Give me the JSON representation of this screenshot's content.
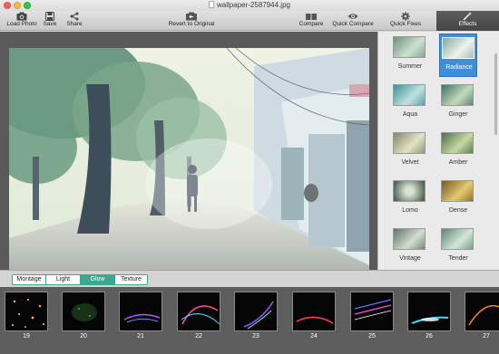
{
  "window": {
    "title": "wallpaper-2587944.jpg"
  },
  "toolbar": {
    "load_photo": "Load Photo",
    "save": "Save",
    "share": "Share",
    "revert": "Revert to Original",
    "compare": "Compare",
    "quick_compare": "Quick Compare",
    "quick_fixes": "Quick Fixes",
    "effects": "Effects"
  },
  "presets": [
    {
      "label": "Summer",
      "selected": false
    },
    {
      "label": "Radiance",
      "selected": true
    },
    {
      "label": "Aqua",
      "selected": false
    },
    {
      "label": "Ginger",
      "selected": false
    },
    {
      "label": "Velvet",
      "selected": false
    },
    {
      "label": "Amber",
      "selected": false
    },
    {
      "label": "Lomo",
      "selected": false
    },
    {
      "label": "Dense",
      "selected": false
    },
    {
      "label": "Vintage",
      "selected": false
    },
    {
      "label": "Tender",
      "selected": false
    }
  ],
  "categories": {
    "items": [
      "Montage",
      "Light",
      "Glow",
      "Texture"
    ],
    "active": "Glow"
  },
  "filmstrip": {
    "frames": [
      "19",
      "20",
      "21",
      "22",
      "23",
      "24",
      "25",
      "26",
      "27"
    ]
  },
  "colors": {
    "accent": "#3aa88c",
    "selection": "#3d90d8",
    "toolbar_active": "#4f4f4f"
  }
}
